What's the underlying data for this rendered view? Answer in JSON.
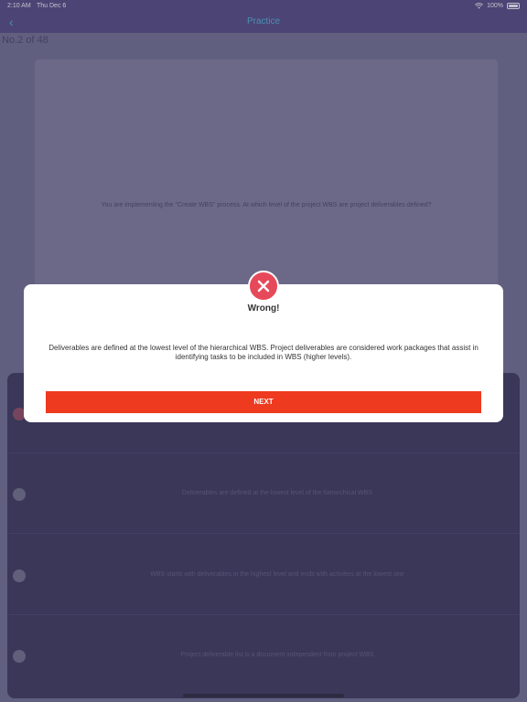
{
  "status_bar": {
    "time": "2:10 AM",
    "date": "Thu Dec 6",
    "battery": "100%"
  },
  "nav": {
    "title": "Practice",
    "back_icon": "chevron-left-icon"
  },
  "question": {
    "counter": "No.2 of 48",
    "text": "You are implementing the \"Create WBS\" process. At which level of the project WBS are project deliverables defined?"
  },
  "answers": [
    {
      "label": "",
      "selected": true
    },
    {
      "label": "Deliverables are defined at the lowest level of the hierarchical WBS",
      "selected": false
    },
    {
      "label": "WBS starts with deliverables in the highest level and ends with activities at the lowest one",
      "selected": false
    },
    {
      "label": "Project deliverable list is a document independent from project WBS",
      "selected": false
    }
  ],
  "modal": {
    "title": "Wrong!",
    "message": "Deliverables are defined at the lowest level of the hierarchical WBS. Project deliverables are considered work packages that assist in identifying tasks to be included in WBS (higher levels).",
    "button_label": "NEXT",
    "icon": "close-icon"
  },
  "colors": {
    "accent_nav": "#4b3f7a",
    "nav_text": "#46b2d6",
    "error_red": "#e64a5a",
    "next_button": "#ee3a1f"
  }
}
